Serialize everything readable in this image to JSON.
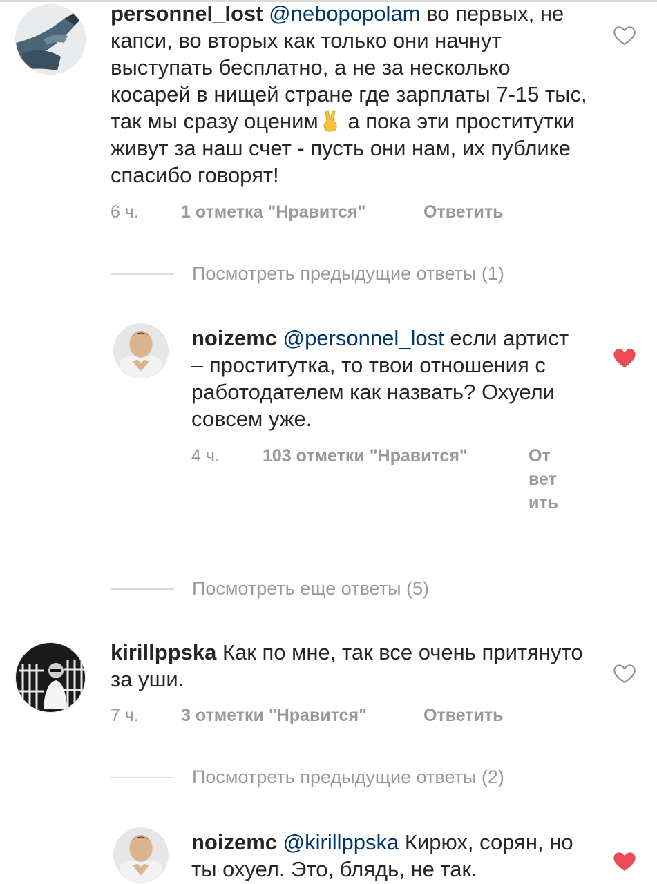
{
  "comments": [
    {
      "username": "personnel_lost",
      "mention": "@nebopopolam",
      "text_before_emoji": " во первых, не капси, во вторых как только они начнут выступать бесплатно, а не за несколько косарей в нищей стране где зарплаты 7-15 тыс, так мы сразу оценим",
      "emoji": "victory-hand",
      "text_after_emoji": " а пока эти проститутки живут за наш счет - пусть они нам, их публике спасибо говорят!",
      "time": "6 ч.",
      "likes": "1 отметка \"Нравится\"",
      "reply": "Ответить",
      "liked": false
    },
    {
      "username": "noizemc",
      "mention": "@personnel_lost",
      "text": " если артист – проститутка, то твои отношения с работодателем как назвать? Охуели совсем уже.",
      "time": "4 ч.",
      "likes": "103 отметки \"Нравится\"",
      "reply": "Ответить",
      "liked": true
    },
    {
      "username": "kirillppska",
      "text": " Как по мне, так все очень притянуто за уши.",
      "time": "7 ч.",
      "likes": "3 отметки \"Нравится\"",
      "reply": "Ответить",
      "liked": false
    },
    {
      "username": "noizemc",
      "mention": "@kirillppska",
      "text": " Кирюх, сорян, но ты охуел. Это, блядь, не так.",
      "liked": true
    }
  ],
  "view_more": [
    "Посмотреть предыдущие ответы (1)",
    "Посмотреть еще ответы (5)",
    "Посмотреть предыдущие ответы (2)"
  ],
  "icons": {
    "heart_outline": "heart-outline-icon",
    "heart_filled": "heart-filled-icon"
  },
  "colors": {
    "text": "#262626",
    "meta": "#999999",
    "mention": "#003569",
    "heart_liked": "#ed4956",
    "heart_unliked": "#8e8e8e"
  }
}
